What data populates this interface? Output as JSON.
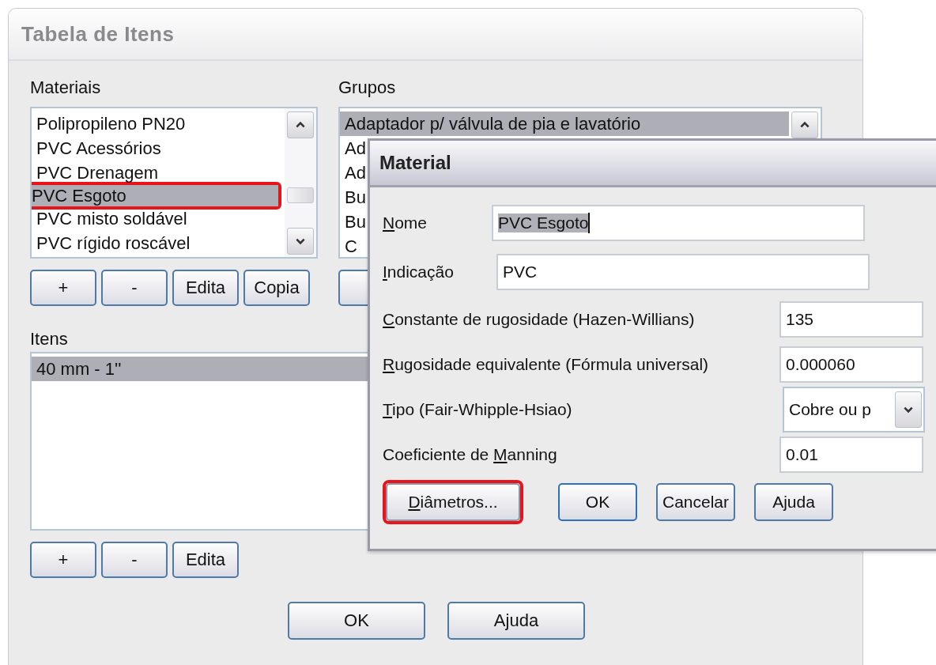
{
  "window": {
    "title": "Tabela de Itens"
  },
  "materials": {
    "label": "Materiais",
    "items": [
      {
        "text": "Polipropileno PN20",
        "selected": false,
        "highlighted": false
      },
      {
        "text": "PVC Acessórios",
        "selected": false,
        "highlighted": false
      },
      {
        "text": "PVC Drenagem",
        "selected": false,
        "highlighted": false
      },
      {
        "text": "PVC Esgoto",
        "selected": true,
        "highlighted": true
      },
      {
        "text": "PVC misto soldável",
        "selected": false,
        "highlighted": false
      },
      {
        "text": "PVC rígido roscável",
        "selected": false,
        "highlighted": false
      }
    ],
    "buttons": [
      "+",
      "-",
      "Edita",
      "Copia"
    ]
  },
  "groups": {
    "label": "Grupos",
    "items": [
      {
        "text": "Adaptador  p/ válvula de pia e lavatório",
        "selected": true
      },
      {
        "text": "Ad",
        "selected": false
      },
      {
        "text": "Ad",
        "selected": false
      },
      {
        "text": "Bu",
        "selected": false
      },
      {
        "text": "Bu",
        "selected": false
      },
      {
        "text": "C",
        "selected": false
      }
    ]
  },
  "items": {
    "label": "Itens",
    "items": [
      {
        "text": "40 mm - 1''",
        "selected": true
      }
    ],
    "buttons": [
      "+",
      "-",
      "Edita"
    ]
  },
  "buttons": [
    "OK",
    "Ajuda"
  ],
  "dialog": {
    "title": "Material",
    "fields": [
      {
        "kind": "wide",
        "label": {
          "key": "N",
          "after": "ome"
        },
        "value": "PVC Esgoto",
        "text_selected": true
      },
      {
        "kind": "wide",
        "label": {
          "key": "I",
          "after": "ndicação"
        },
        "value": "PVC"
      },
      {
        "kind": "text",
        "label": {
          "key": "C",
          "after": "onstante de rugosidade (Hazen-Willians)"
        },
        "value": "135"
      },
      {
        "kind": "text",
        "label": {
          "key": "R",
          "after": "ugosidade equivalente (Fórmula universal)"
        },
        "value": "0.000060"
      },
      {
        "kind": "select",
        "label": {
          "key": "T",
          "after": "ipo (Fair-Whipple-Hsiao)"
        },
        "value": "Cobre ou p"
      },
      {
        "kind": "text",
        "label": {
          "before": "Coeficiente de ",
          "key": "M",
          "after": "anning"
        },
        "value": "0.01"
      }
    ],
    "buttons": [
      {
        "label": {
          "key": "D",
          "after": "iâmetros..."
        },
        "default": false,
        "highlighted": true
      },
      {
        "label": {
          "before": "OK"
        },
        "default": true,
        "highlighted": false
      },
      {
        "label": {
          "before": "Cancelar"
        },
        "default": false,
        "highlighted": false
      },
      {
        "label": {
          "before": "Ajuda"
        },
        "default": false,
        "highlighted": false
      }
    ]
  }
}
